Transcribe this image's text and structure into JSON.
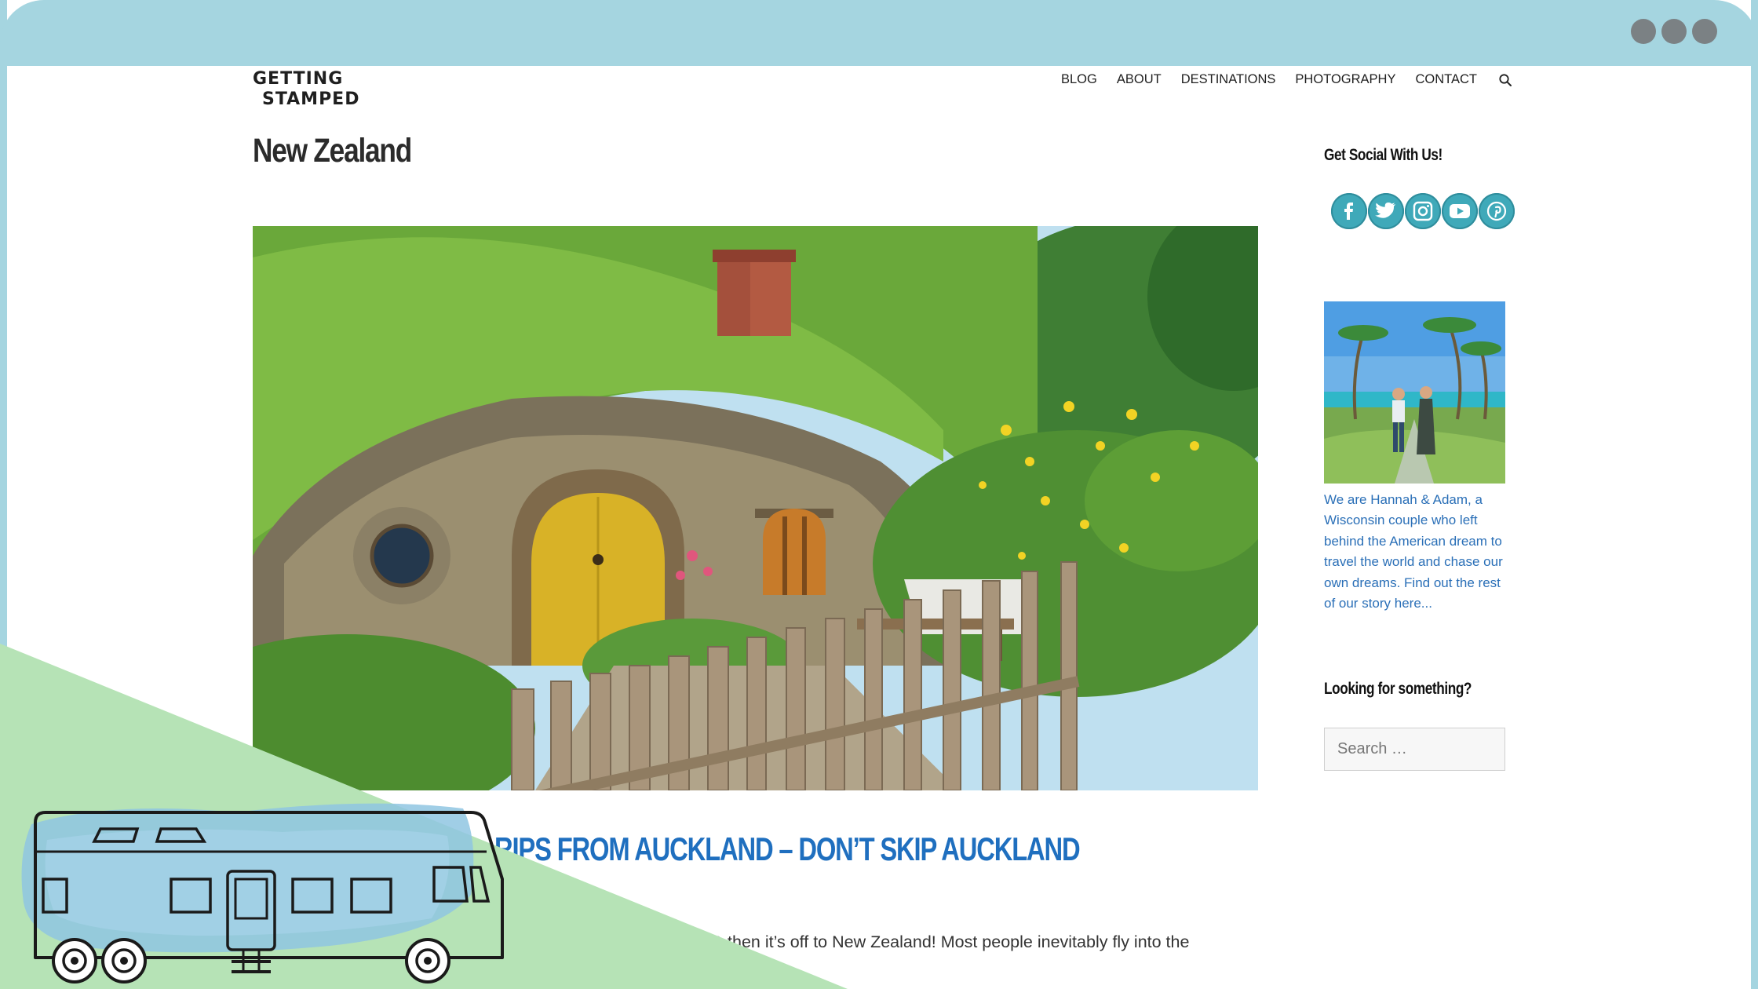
{
  "window": {
    "controls": [
      "window-dot-1",
      "window-dot-2",
      "window-dot-3"
    ]
  },
  "header": {
    "logo_line1": "GETTING",
    "logo_line2": "STAMPED",
    "nav": [
      "BLOG",
      "ABOUT",
      "DESTINATIONS",
      "PHOTOGRAPHY",
      "CONTACT"
    ],
    "search_icon": "search-icon"
  },
  "main": {
    "page_title": "New Zealand",
    "post_title": "RIPS FROM AUCKLAND – DON’T SKIP AUCKLAND",
    "excerpt": "k & then it’s off to New Zealand! Most people inevitably fly into the"
  },
  "sidebar": {
    "social_title": "Get Social With Us!",
    "social_icons": [
      "facebook-icon",
      "twitter-icon",
      "instagram-icon",
      "youtube-icon",
      "pinterest-icon"
    ],
    "about_text": "We are Hannah & Adam, a Wisconsin couple who left behind the American dream to travel the world and chase our own dreams. Find out the rest of our story here...",
    "search_title": "Looking for something?",
    "search_placeholder": "Search …"
  },
  "colors": {
    "frame": "#a5d5e0",
    "link": "#1f6fbf",
    "social": "#3fa9b9",
    "overlay_green": "#b6e3b6",
    "overlay_blue": "#8fc6e2"
  },
  "overlay": {
    "icon": "rv-camper-icon"
  }
}
